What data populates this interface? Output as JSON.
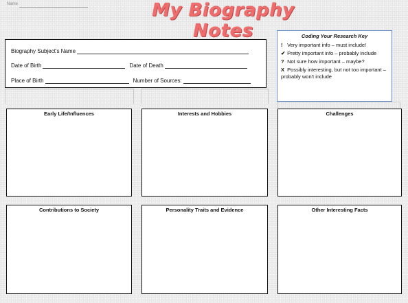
{
  "header": {
    "name_label": "Name",
    "title": "My Biography Notes"
  },
  "info": {
    "subject_label": "Biography Subject's Name",
    "dob_label": "Date of Birth",
    "dod_label": "Date of Death",
    "pob_label": "Place of Birth",
    "sources_label": "Number of Sources:"
  },
  "key": {
    "title": "Coding Your Research Key",
    "items": [
      {
        "symbol": "!",
        "text": "Very important info – must include!"
      },
      {
        "symbol": "✔",
        "text": "Pretty important info – probably include"
      },
      {
        "symbol": "?",
        "text": "Not sure how important – maybe?"
      },
      {
        "symbol": "X",
        "text": "Possibly interesting, but not too important – probably won't include"
      }
    ]
  },
  "sections": [
    {
      "title": "Early Life/Influences"
    },
    {
      "title": "Interests and Hobbies"
    },
    {
      "title": "Challenges"
    },
    {
      "title": "Contributions to Society"
    },
    {
      "title": "Personality Traits and Evidence"
    },
    {
      "title": "Other Interesting Facts"
    }
  ]
}
